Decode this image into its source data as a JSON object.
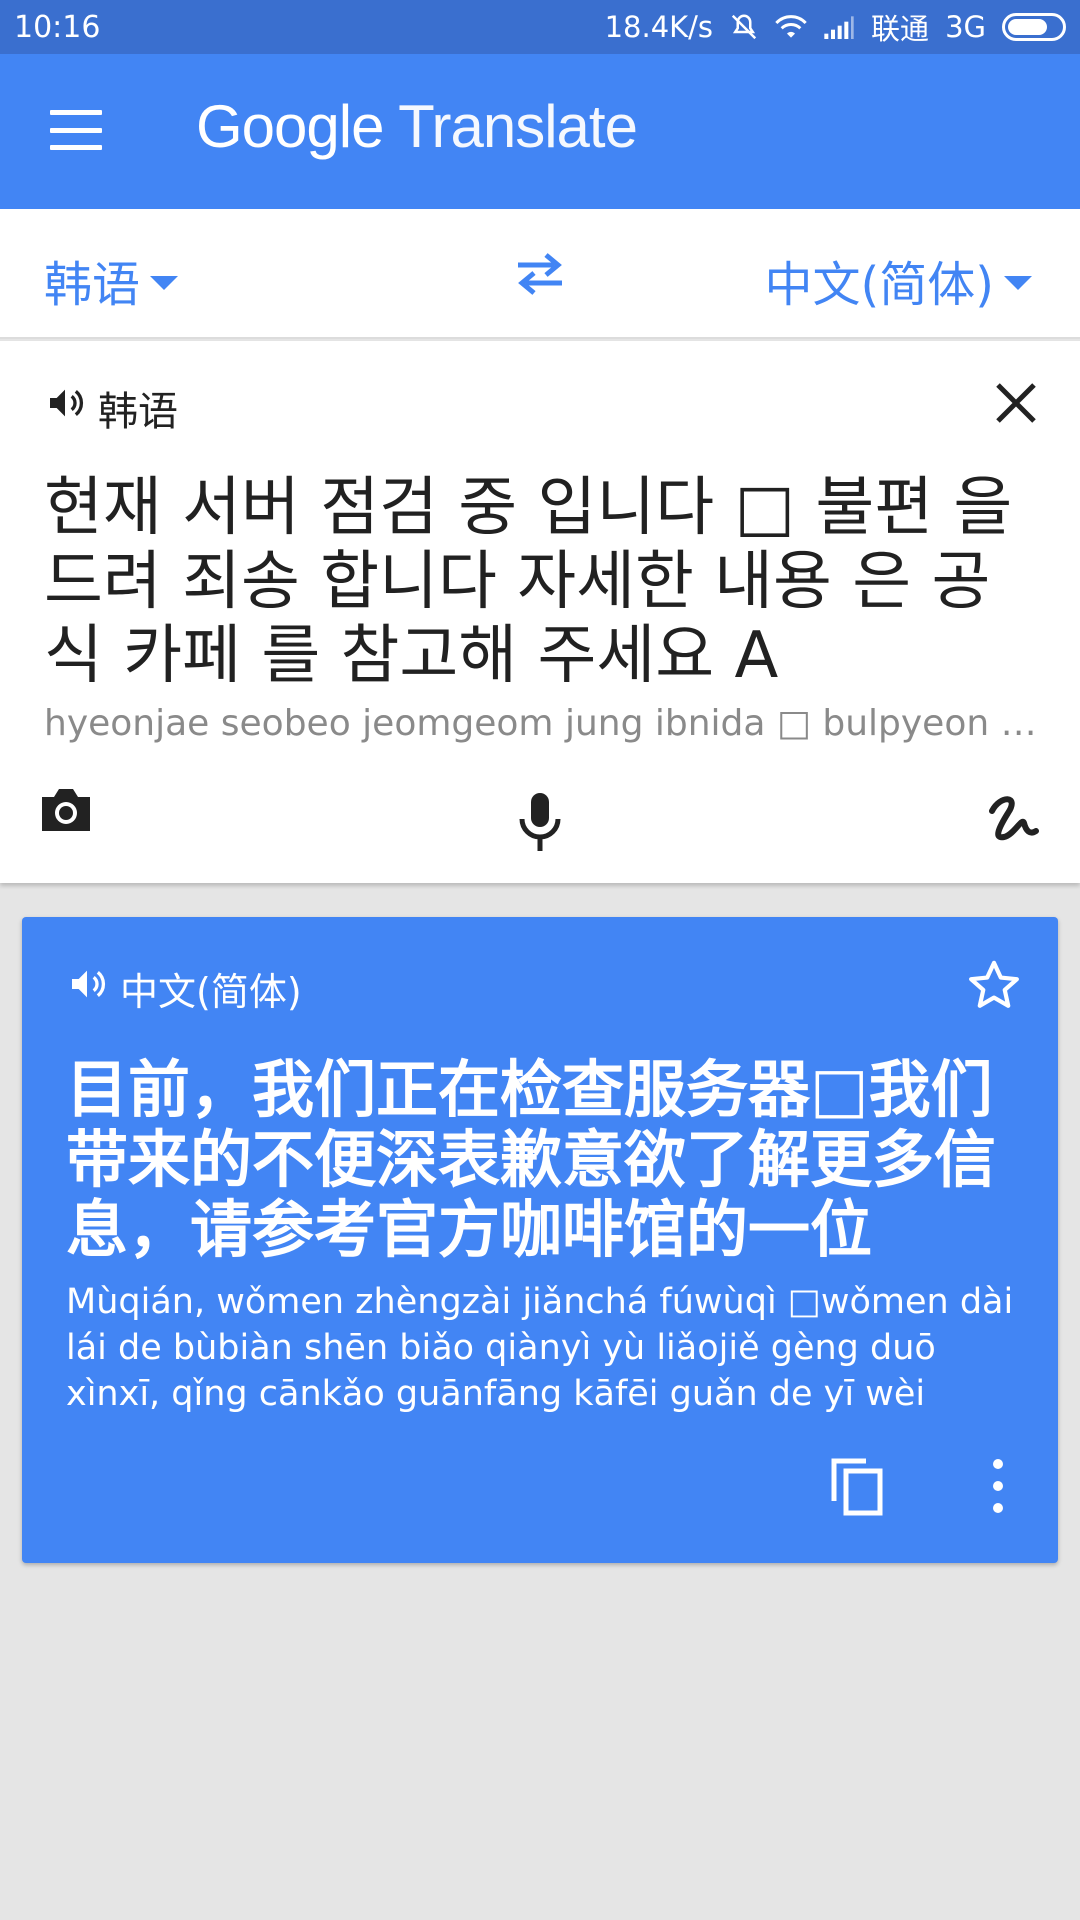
{
  "status_bar": {
    "time": "10:16",
    "net_speed": "18.4K/s",
    "carrier": "联通",
    "network": "3G",
    "icons": [
      "mute-icon",
      "wifi-icon",
      "signal-icon",
      "battery-icon"
    ]
  },
  "app_bar": {
    "title_google": "Google",
    "title_translate": "Translate",
    "menu_icon": "menu-icon",
    "color": "#4285f4"
  },
  "lang_bar": {
    "source_lang": "韩语",
    "target_lang": "中文(简体)",
    "swap_icon": "swap-arrows-icon"
  },
  "input": {
    "label": "韩语",
    "text": "현재 서버 점검 중 입니다 □ 불편 을 드려 죄송 합니다 자세한 내용 은 공식 카페 를 참고해 주세요 A",
    "romanization": "hyeonjae seobeo jeomgeom jung ibnida □ bulpyeon eul deulyeo joesong habnida",
    "tools": [
      "camera-icon",
      "mic-icon",
      "handwriting-icon"
    ]
  },
  "result": {
    "label": "中文(简体)",
    "translation": "目前，我们正在检查服务器□我们带来的不便深表歉意欲了解更多信息，请参考官方咖啡馆的一位",
    "pinyin": "Mùqián, wǒmen zhèngzài jiǎnchá fúwùqì □wǒmen dài lái de bùbiàn shēn biǎo qiànyì yù liǎojiě gèng duō xìnxī, qǐng cānkǎo guānfāng kāfēi guǎn de yī wèi",
    "card_color": "#4285f4"
  }
}
